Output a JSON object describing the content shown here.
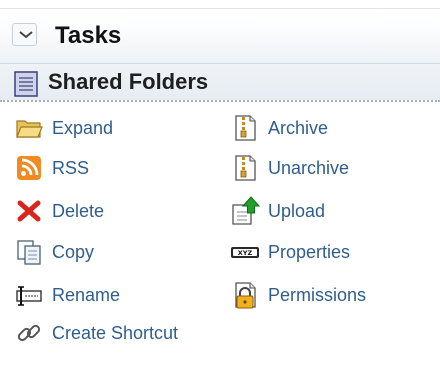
{
  "tasks": {
    "title": "Tasks"
  },
  "section": {
    "title": "Shared Folders"
  },
  "actions_left": [
    {
      "label": "Expand",
      "icon": "folder-open-icon"
    },
    {
      "label": "RSS",
      "icon": "rss-icon"
    },
    {
      "label": "Delete",
      "icon": "delete-x-icon"
    },
    {
      "label": "Copy",
      "icon": "copy-icon"
    },
    {
      "label": "Rename",
      "icon": "rename-icon"
    },
    {
      "label": "Create Shortcut",
      "icon": "chain-link-icon"
    }
  ],
  "actions_right": [
    {
      "label": "Archive",
      "icon": "zip-file-icon"
    },
    {
      "label": "Unarchive",
      "icon": "zip-file-icon"
    },
    {
      "label": "Upload",
      "icon": "upload-arrow-icon"
    },
    {
      "label": "Properties",
      "icon": "xyz-properties-icon"
    },
    {
      "label": "Permissions",
      "icon": "lock-document-icon"
    }
  ],
  "colors": {
    "link": "#2f5e8c",
    "header_bg": "#eef2f6",
    "section_bg": "#e9eef3",
    "rss": "#f08a24",
    "delete": "#d9261c",
    "upload": "#1fa12b"
  }
}
